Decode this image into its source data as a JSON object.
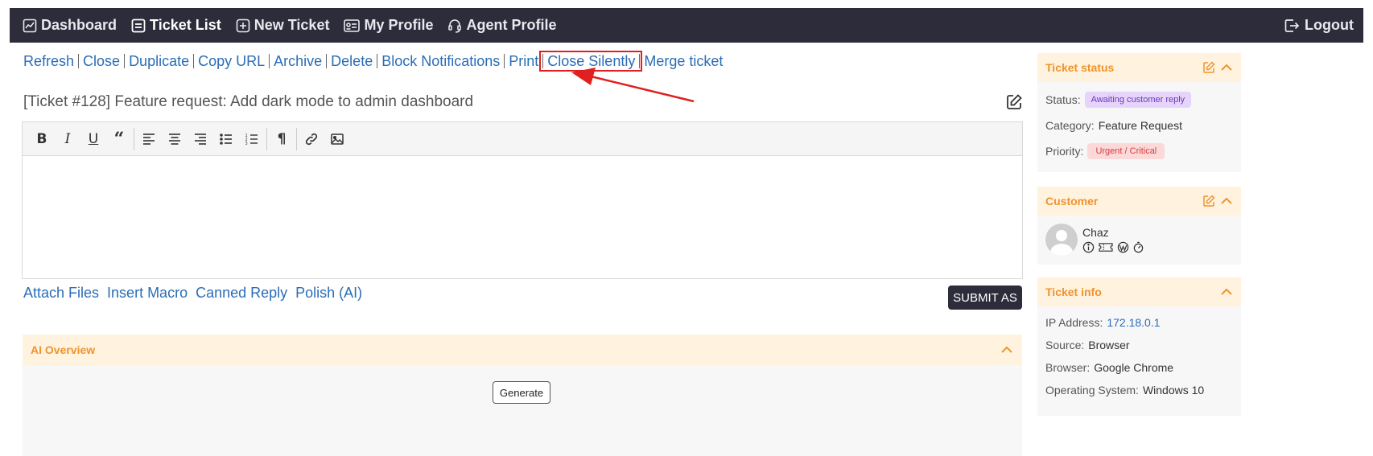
{
  "nav": {
    "items": [
      {
        "label": "Dashboard",
        "icon": "chart-icon"
      },
      {
        "label": "Ticket List",
        "icon": "list-icon"
      },
      {
        "label": "New Ticket",
        "icon": "plus-square-icon"
      },
      {
        "label": "My Profile",
        "icon": "id-card-icon"
      },
      {
        "label": "Agent Profile",
        "icon": "headset-icon"
      }
    ],
    "logout": "Logout"
  },
  "actions": [
    "Refresh",
    "Close",
    "Duplicate",
    "Copy URL",
    "Archive",
    "Delete",
    "Block Notifications",
    "Print",
    "Close Silently",
    "Merge ticket"
  ],
  "ticket": {
    "title": "[Ticket #128] Feature request: Add dark mode to admin dashboard"
  },
  "reply": {
    "links": [
      "Attach Files",
      "Insert Macro",
      "Canned Reply",
      "Polish (AI)"
    ],
    "submit_label": "SUBMIT AS"
  },
  "ai_overview": {
    "title": "AI Overview",
    "generate_label": "Generate"
  },
  "sidebar": {
    "status": {
      "title": "Ticket status",
      "status_label": "Status:",
      "status_value": "Awaiting customer reply",
      "category_label": "Category:",
      "category_value": "Feature Request",
      "priority_label": "Priority:",
      "priority_value": "Urgent / Critical"
    },
    "customer": {
      "title": "Customer",
      "name": "Chaz"
    },
    "info": {
      "title": "Ticket info",
      "ip_label": "IP Address:",
      "ip_value": "172.18.0.1",
      "source_label": "Source:",
      "source_value": "Browser",
      "browser_label": "Browser:",
      "browser_value": "Google Chrome",
      "os_label": "Operating System:",
      "os_value": "Windows 10"
    }
  },
  "colors": {
    "navbar": "#2c2c3b",
    "link": "#2a6db8",
    "accent_orange": "#f0932b",
    "highlight_red": "#e02020"
  }
}
